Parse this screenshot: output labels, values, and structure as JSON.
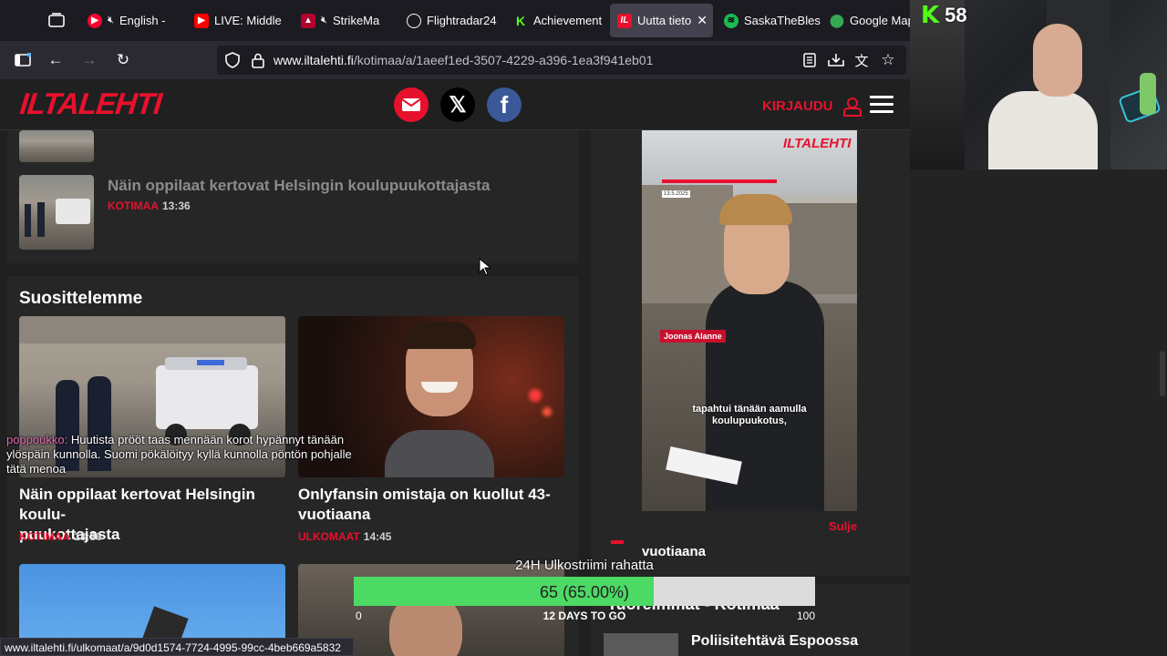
{
  "tabs": [
    {
      "label": "English -",
      "icon": "youtube-music-icon",
      "muted": true
    },
    {
      "label": "LIVE: Middle",
      "icon": "youtube-icon",
      "muted": false
    },
    {
      "label": "StrikeMa",
      "icon": "strikemap-icon",
      "muted": true
    },
    {
      "label": "Flightradar24",
      "icon": "flightradar-icon",
      "muted": false
    },
    {
      "label": "Achievement",
      "icon": "kick-icon",
      "muted": false
    },
    {
      "label": "Uutta tieto",
      "icon": "iltalehti-icon",
      "muted": false,
      "active": true
    },
    {
      "label": "SaskaTheBles",
      "icon": "spotify-icon",
      "muted": false
    },
    {
      "label": "Google Map",
      "icon": "google-maps-icon",
      "muted": false
    }
  ],
  "nav": {
    "url_domain": "www.iltalehti.fi",
    "url_path": "/kotimaa/a/1aeef1ed-3507-4229-a396-1ea3f941eb01"
  },
  "site": {
    "logo": "ILTALEHTI",
    "login_label": "KIRJAUDU"
  },
  "list_item": {
    "title": "Näin oppilaat kertovat Helsingin koulupuukottajasta",
    "category": "KOTIMAA",
    "time": "13:36"
  },
  "section": {
    "title": "Suosittelemme"
  },
  "cards": [
    {
      "title_line1": "Näin oppilaat kertovat Helsingin koulu-",
      "title_line2": "puukottajasta",
      "category": "KOTIMAA",
      "time": "13:36"
    },
    {
      "title_line1": "Onlyfansin omistaja on kuollut 43-",
      "title_line2": "vuotiaana",
      "category": "ULKOMAAT",
      "time": "14:45"
    }
  ],
  "video": {
    "logo": "ILTALEHTI",
    "date": "13.5.2025",
    "name_tag": "Joonas Alanne",
    "caption_line1": "tapahtui tänään aamulla",
    "caption_line2": "koulupuukotus,",
    "close_label": "Sulje"
  },
  "right": {
    "partial_title": "vuotiaana",
    "section_title": "Tuoreimmat - Kotimaa",
    "item_title": "Poliisitehtävä Espoossa"
  },
  "stream": {
    "kick_count": "58",
    "chat_user": "poppoukko:",
    "chat_message": " Huutista prööt taas mennään korot hypännyt tänään ylöspäin kunnolla. Suomi pökälöityy kyllä kunnolla pöntön pohjalle tätä menoa",
    "goal_title": "24H Ulkostriimi rahatta",
    "goal_value": "65 (65.00%)",
    "goal_fraction": 0.65,
    "goal_min": "0",
    "goal_max": "100",
    "goal_subtitle": "12 DAYS TO GO"
  },
  "status_url": "www.iltalehti.fi/ulkomaat/a/9d0d1574-7724-4995-99cc-4beb669a5832",
  "colors": {
    "brand_red": "#e8112d",
    "goal_green": "#4cd964",
    "kick_green": "#53fc18"
  }
}
